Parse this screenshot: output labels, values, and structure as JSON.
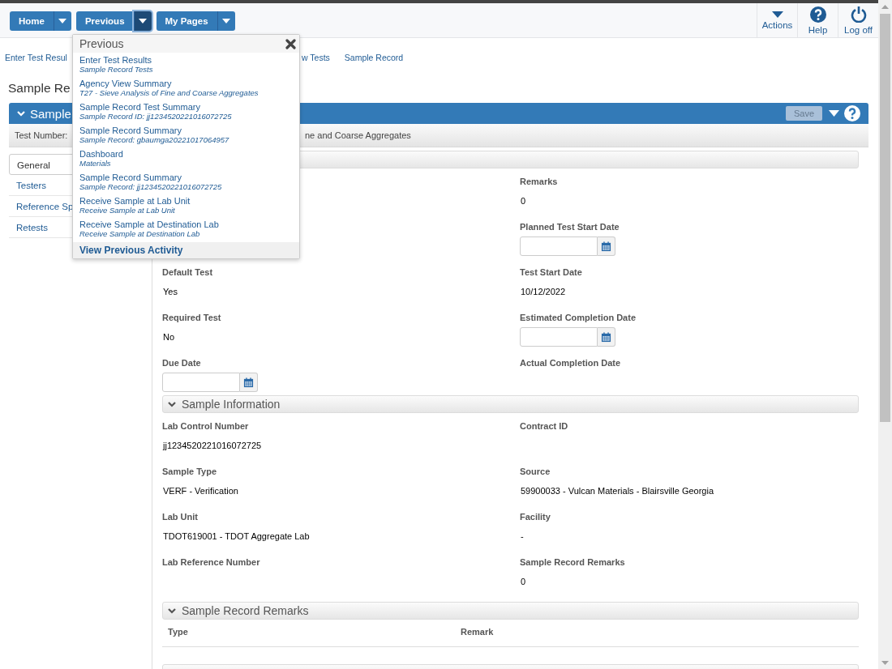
{
  "toolbar": {
    "buttons": [
      {
        "label": "Home",
        "active": false
      },
      {
        "label": "Previous",
        "active": true
      },
      {
        "label": "My Pages",
        "active": false
      }
    ],
    "actions": [
      {
        "kind": "actions",
        "label": "Actions"
      },
      {
        "kind": "help",
        "label": "Help"
      },
      {
        "kind": "logoff",
        "label": "Log off"
      }
    ]
  },
  "breadcrumbs": [
    "Enter Test Resul",
    "w Tests",
    "Sample Record"
  ],
  "page_title": "Sample Re",
  "panel": {
    "title": "Sample",
    "save_button": {
      "label": "Save",
      "disabled": true
    },
    "subheader": {
      "left": "Test Number:",
      "right": "ne and Coarse Aggregates"
    }
  },
  "sidebar": [
    {
      "label": "General",
      "selected": true
    },
    {
      "label": "Testers",
      "selected": false
    },
    {
      "label": "Reference Sp",
      "selected": false
    },
    {
      "label": "Retests",
      "selected": false
    }
  ],
  "general_section": {
    "left_fields": [
      {
        "label": "Default Test",
        "kind": "text",
        "value": "Yes"
      },
      {
        "label": "Required Test",
        "kind": "text",
        "value": "No"
      },
      {
        "label": "Due Date",
        "kind": "date"
      }
    ],
    "right_fields": [
      {
        "label": "Remarks",
        "kind": "text",
        "value": "0"
      },
      {
        "label": "Planned Test Start Date",
        "kind": "date"
      },
      {
        "label": "Test Start Date",
        "kind": "text",
        "value": "10/12/2022"
      },
      {
        "label": "Estimated Completion Date",
        "kind": "date"
      },
      {
        "label": "Actual Completion Date",
        "kind": "text"
      }
    ]
  },
  "sample_information": {
    "title": "Sample Information",
    "fields": [
      {
        "label": "Lab Control Number",
        "kind": "text",
        "value": "jj1234520221016072725"
      },
      {
        "label": "Contract ID",
        "kind": "text"
      },
      {
        "label": "Sample Type",
        "kind": "text",
        "value": "VERF - Verification"
      },
      {
        "label": "Source",
        "kind": "text",
        "value": "59900033 - Vulcan Materials - Blairsville Georgia"
      },
      {
        "label": "Lab Unit",
        "kind": "text",
        "value": "TDOT619001 - TDOT Aggregate Lab"
      },
      {
        "label": "Facility",
        "kind": "text",
        "value": "-"
      },
      {
        "label": "Lab Reference Number",
        "kind": "text"
      },
      {
        "label": "Sample Record Remarks",
        "kind": "text",
        "value": "0"
      }
    ]
  },
  "remarks_section": {
    "title": "Sample Record Remarks",
    "columns": [
      "Type",
      "Remark"
    ]
  },
  "previous_menu": {
    "title": "Previous",
    "items": [
      {
        "title": "Enter Test Results",
        "subtitle": "Sample Record Tests"
      },
      {
        "title": "Agency View Summary",
        "subtitle": "T27 - Sieve Analysis of Fine and Coarse Aggregates"
      },
      {
        "title": "Sample Record Test Summary",
        "subtitle": "Sample Record ID: jj1234520221016072725"
      },
      {
        "title": "Sample Record Summary",
        "subtitle": "Sample Record: gbaumga20221017064957"
      },
      {
        "title": "Dashboard",
        "subtitle": "Materials"
      },
      {
        "title": "Sample Record Summary",
        "subtitle": "Sample Record: jj1234520221016072725"
      },
      {
        "title": "Receive Sample at Lab Unit",
        "subtitle": "Receive Sample at Lab Unit"
      },
      {
        "title": "Receive Sample at Destination Lab",
        "subtitle": "Receive Sample at Destination Lab"
      }
    ],
    "footer": "View Previous Activity"
  }
}
